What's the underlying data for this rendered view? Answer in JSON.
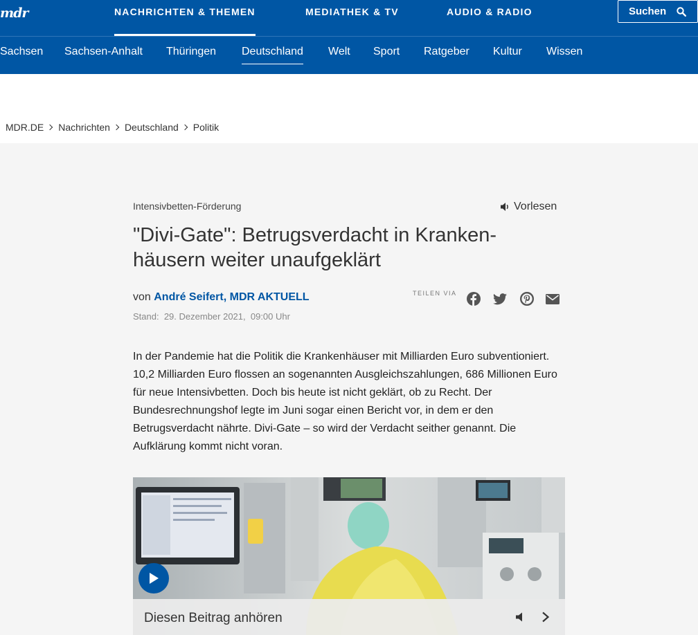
{
  "header": {
    "logo": "mdr",
    "top_nav": [
      "NACHRICHTEN & THEMEN",
      "MEDIATHEK & TV",
      "AUDIO & RADIO"
    ],
    "search_label": "Suchen",
    "sub_nav": [
      "Sachsen",
      "Sachsen-Anhalt",
      "Thüringen",
      "Deutschland",
      "Welt",
      "Sport",
      "Ratgeber",
      "Kultur",
      "Wissen"
    ],
    "active_sub": "Deutschland"
  },
  "breadcrumb": [
    "MDR.DE",
    "Nachrichten",
    "Deutschland",
    "Politik"
  ],
  "article": {
    "kicker": "Intensivbetten-Förderung",
    "read_aloud": "Vorlesen",
    "headline_line1": "\"Divi-Gate\": Betrugsverdacht in Kranken-",
    "headline_line2": "häusern weiter unaufgeklärt",
    "byline_prefix": "von",
    "author": "André Seifert, MDR AKTUELL",
    "stand_label": "Stand:",
    "stand_date": "29. Dezember 2021,",
    "stand_time": "09:00 Uhr",
    "share_label": "TEILEN VIA",
    "lead": "In der Pandemie hat die Politik die Krankenhäuser mit Milliarden Euro subventioniert. 10,2 Milliarden Euro flossen an sogenannten Ausgleichszahlungen, 686 Millionen Euro für neue Intensivbetten. Doch bis heute ist nicht geklärt, ob zu Recht. Der Bundesrechnungshof legte im Juni sogar einen Bericht vor, in dem er den Betrugsverdacht nährte. Divi-Gate – so wird der Verdacht seither genannt. Die Aufklärung kommt nicht voran.",
    "audio_label": "Diesen Beitrag anhören"
  },
  "colors": {
    "brand": "#0056a4",
    "background": "#f5f5f5"
  },
  "icons": [
    "search-icon",
    "speaker-icon",
    "facebook-icon",
    "twitter-icon",
    "pinterest-icon",
    "mail-icon",
    "play-icon",
    "volume-icon",
    "chevron-right-icon"
  ]
}
